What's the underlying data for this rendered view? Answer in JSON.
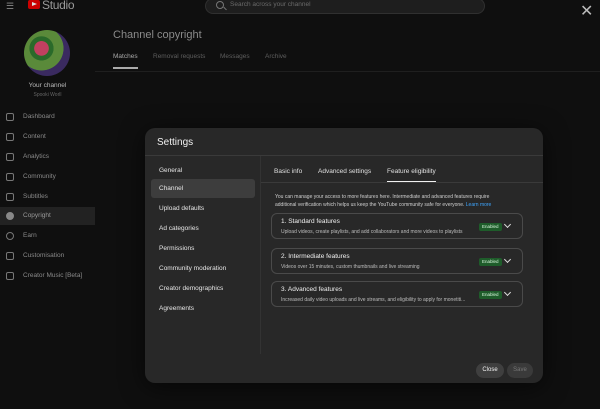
{
  "app": {
    "studio_label": "Studio",
    "search_placeholder": "Search across your channel",
    "close_glyph": "✕"
  },
  "sidebar": {
    "channel_title": "Your channel",
    "channel_handle": "Spooki Worll",
    "items": [
      {
        "label": "Dashboard",
        "icon": "dashboard-icon"
      },
      {
        "label": "Content",
        "icon": "content-icon"
      },
      {
        "label": "Analytics",
        "icon": "analytics-icon"
      },
      {
        "label": "Community",
        "icon": "community-icon"
      },
      {
        "label": "Subtitles",
        "icon": "subtitles-icon"
      },
      {
        "label": "Copyright",
        "icon": "copyright-icon",
        "active": true
      },
      {
        "label": "Earn",
        "icon": "earn-icon"
      },
      {
        "label": "Customisation",
        "icon": "customisation-icon"
      },
      {
        "label": "Creator Music [Beta]",
        "icon": "creator-music-icon"
      }
    ]
  },
  "main": {
    "title": "Channel copyright",
    "tabs": [
      {
        "label": "Matches",
        "active": true
      },
      {
        "label": "Removal requests"
      },
      {
        "label": "Messages"
      },
      {
        "label": "Archive"
      }
    ]
  },
  "modal": {
    "title": "Settings",
    "nav": [
      {
        "label": "General"
      },
      {
        "label": "Channel",
        "active": true
      },
      {
        "label": "Upload defaults"
      },
      {
        "label": "Ad categories"
      },
      {
        "label": "Permissions"
      },
      {
        "label": "Community moderation"
      },
      {
        "label": "Creator demographics"
      },
      {
        "label": "Agreements"
      }
    ],
    "tabs": [
      {
        "label": "Basic info"
      },
      {
        "label": "Advanced settings"
      },
      {
        "label": "Feature eligibility",
        "active": true
      }
    ],
    "intro_line1": "You can manage your access to more features here. Intermediate and advanced features require",
    "intro_line2": "additional verification which helps us keep the YouTube community safe for everyone.",
    "learn_more": "Learn more",
    "features": [
      {
        "title": "1. Standard features",
        "desc": "Upload videos, create playlists, and add collaborators and more videos to playlists",
        "status": "Enabled"
      },
      {
        "title": "2. Intermediate features",
        "desc": "Videos over 15 minutes, custom thumbnails and live streaming",
        "status": "Enabled"
      },
      {
        "title": "3. Advanced features",
        "desc": "Increased daily video uploads and live streams, and eligibility to apply for monetiti...",
        "status": "Enabled"
      }
    ],
    "close_label": "Close",
    "save_label": "Save"
  },
  "colors": {
    "background": "#0f0f0f",
    "modal": "#282828",
    "enabled_badge": "#1e5c2a",
    "link": "#3ea6ff",
    "brand": "#cc0000"
  }
}
